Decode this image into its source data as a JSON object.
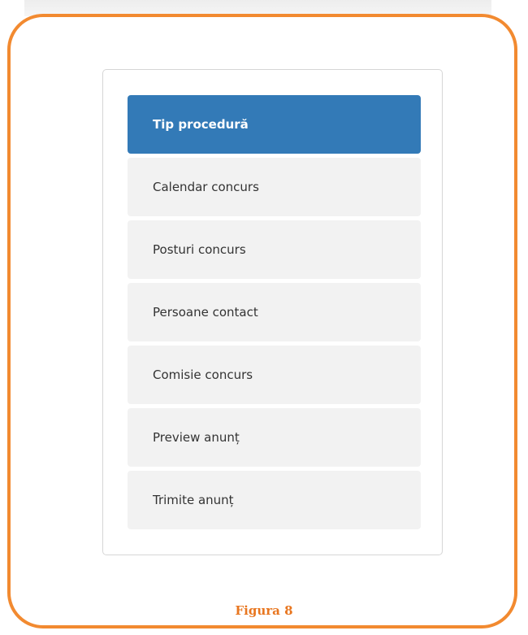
{
  "colors": {
    "frame_border": "#f28a30",
    "active_step_bg": "#337ab7",
    "step_bg": "#f2f2f2",
    "caption": "#e8761f"
  },
  "wizard": {
    "active_index": 0,
    "steps": [
      {
        "label": "Tip procedură"
      },
      {
        "label": "Calendar concurs"
      },
      {
        "label": "Posturi concurs"
      },
      {
        "label": "Persoane contact"
      },
      {
        "label": "Comisie concurs"
      },
      {
        "label": "Preview anunț"
      },
      {
        "label": "Trimite anunț"
      }
    ]
  },
  "caption": "Figura 8"
}
